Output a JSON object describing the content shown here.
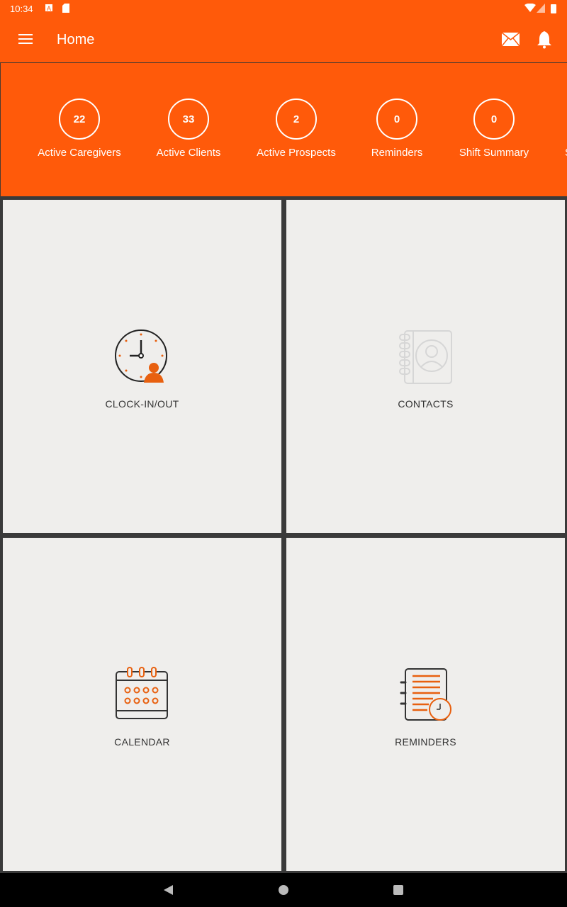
{
  "status_bar": {
    "time": "10:34"
  },
  "toolbar": {
    "title": "Home"
  },
  "stats": [
    {
      "value": "22",
      "label": "Active Caregivers"
    },
    {
      "value": "33",
      "label": "Active Clients"
    },
    {
      "value": "2",
      "label": "Active Prospects"
    },
    {
      "value": "0",
      "label": "Reminders"
    },
    {
      "value": "0",
      "label": "Shift Summary"
    },
    {
      "value": "",
      "label": "S"
    }
  ],
  "tiles": [
    {
      "label": "CLOCK-IN/OUT",
      "icon": "clock-person-icon"
    },
    {
      "label": "CONTACTS",
      "icon": "address-book-icon"
    },
    {
      "label": "CALENDAR",
      "icon": "calendar-icon"
    },
    {
      "label": "REMINDERS",
      "icon": "reminder-notebook-icon"
    }
  ],
  "colors": {
    "accent": "#ff5a0a",
    "tile": "#efeeec",
    "divider": "#3a3a3a"
  }
}
